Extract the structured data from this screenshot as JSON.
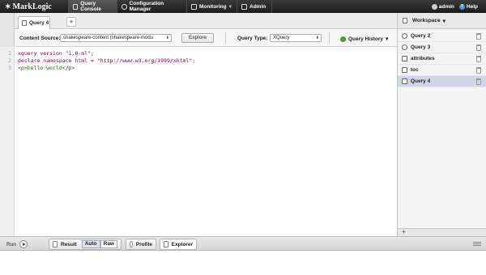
{
  "brand": {
    "name": "MarkLogic",
    "mark": "✶"
  },
  "nav": {
    "tabs": [
      {
        "label": "Query Console",
        "icon": "console-icon",
        "active": true
      },
      {
        "label": "Configuration Manager",
        "icon": "gear-icon",
        "active": false
      },
      {
        "label": "Monitoring",
        "icon": "monitor-icon",
        "active": false
      },
      {
        "label": "Admin",
        "icon": "admin-icon",
        "active": false
      }
    ],
    "user": "admin",
    "help": "Help"
  },
  "query_tabs": {
    "active": "Query 4",
    "add": "+"
  },
  "controls": {
    "content_source_label": "Content Source:",
    "content_source_value": "shakespeare-content (shakespeare-modu",
    "explore_label": "Explore",
    "query_type_label": "Query Type:",
    "query_type_value": "XQuery",
    "history_label": "Query History"
  },
  "editor": {
    "lines": [
      {
        "num": "1",
        "text": "xquery version \"1.0-ml\";"
      },
      {
        "num": "2",
        "text": "declare namespace html = \"http://www.w3.org/1999/xhtml\";"
      },
      {
        "num": "3",
        "text": "<p>hello world</p>"
      }
    ]
  },
  "workspace": {
    "title": "Workspace",
    "items": [
      {
        "label": "Query 2",
        "icon": "query-icon",
        "selected": false
      },
      {
        "label": "Query 3",
        "icon": "query-icon",
        "selected": false
      },
      {
        "label": "attributes",
        "icon": "document-icon",
        "selected": false
      },
      {
        "label": "toc",
        "icon": "document-icon",
        "selected": false
      },
      {
        "label": "Query 4",
        "icon": "document-icon",
        "selected": true
      }
    ],
    "add": "+"
  },
  "bottom": {
    "run": "Run",
    "result": "Result",
    "auto": "Auto",
    "raw": "Raw",
    "profile": "Profile",
    "explorer": "Explorer"
  }
}
